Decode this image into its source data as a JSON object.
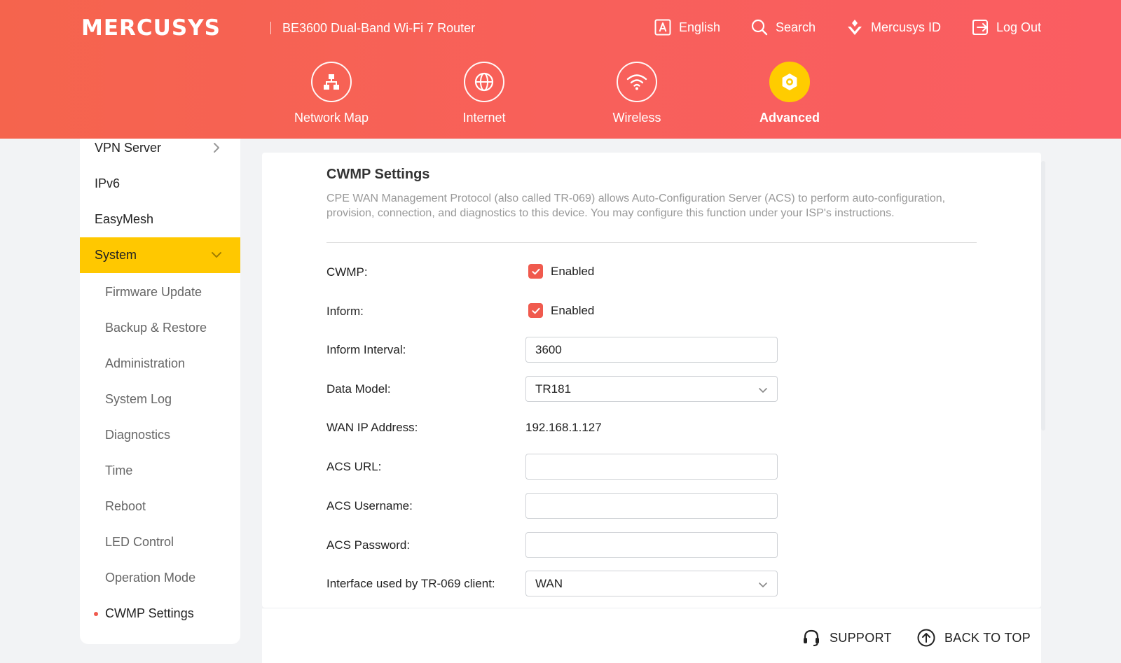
{
  "header": {
    "logo": "MERCUSYS",
    "model": "BE3600 Dual-Band Wi-Fi 7 Router",
    "links": {
      "language": "English",
      "search": "Search",
      "account": "Mercusys ID",
      "logout": "Log Out"
    },
    "nav": [
      {
        "label": "Network Map",
        "icon": "network-map-icon"
      },
      {
        "label": "Internet",
        "icon": "globe-icon"
      },
      {
        "label": "Wireless",
        "icon": "wifi-icon"
      },
      {
        "label": "Advanced",
        "icon": "gear-icon",
        "active": true
      }
    ]
  },
  "sidebar": {
    "items": [
      {
        "label": "VPN Server"
      },
      {
        "label": "IPv6"
      },
      {
        "label": "EasyMesh"
      },
      {
        "label": "System",
        "active": true
      }
    ],
    "system_children": [
      "Firmware Update",
      "Backup & Restore",
      "Administration",
      "System Log",
      "Diagnostics",
      "Time",
      "Reboot",
      "LED Control",
      "Operation Mode",
      "CWMP Settings"
    ],
    "current": "CWMP Settings"
  },
  "main": {
    "title": "CWMP Settings",
    "description": "CPE WAN Management Protocol (also called TR-069) allows Auto-Configuration Server (ACS) to perform auto-configuration, provision, connection, and diagnostics to this device. You may configure this function under your ISP's instructions.",
    "fields": {
      "cwmp": {
        "label": "CWMP:",
        "checkbox_label": "Enabled",
        "checked": true
      },
      "inform": {
        "label": "Inform:",
        "checkbox_label": "Enabled",
        "checked": true
      },
      "inform_interval": {
        "label": "Inform Interval:",
        "value": "3600"
      },
      "data_model": {
        "label": "Data Model:",
        "value": "TR181"
      },
      "wan_ip": {
        "label": "WAN IP Address:",
        "value": "192.168.1.127"
      },
      "acs_url": {
        "label": "ACS URL:",
        "value": ""
      },
      "acs_username": {
        "label": "ACS Username:",
        "value": ""
      },
      "acs_password": {
        "label": "ACS Password:",
        "value": ""
      },
      "interface": {
        "label": "Interface used by TR-069 client:",
        "value": "WAN"
      }
    }
  },
  "footer": {
    "support": "SUPPORT",
    "back_to_top": "BACK TO TOP"
  },
  "colors": {
    "header_gradient_start": "#f5644d",
    "header_gradient_end": "#fa5d62",
    "active_accent": "#ffc800",
    "checkbox": "#f05a4e"
  }
}
